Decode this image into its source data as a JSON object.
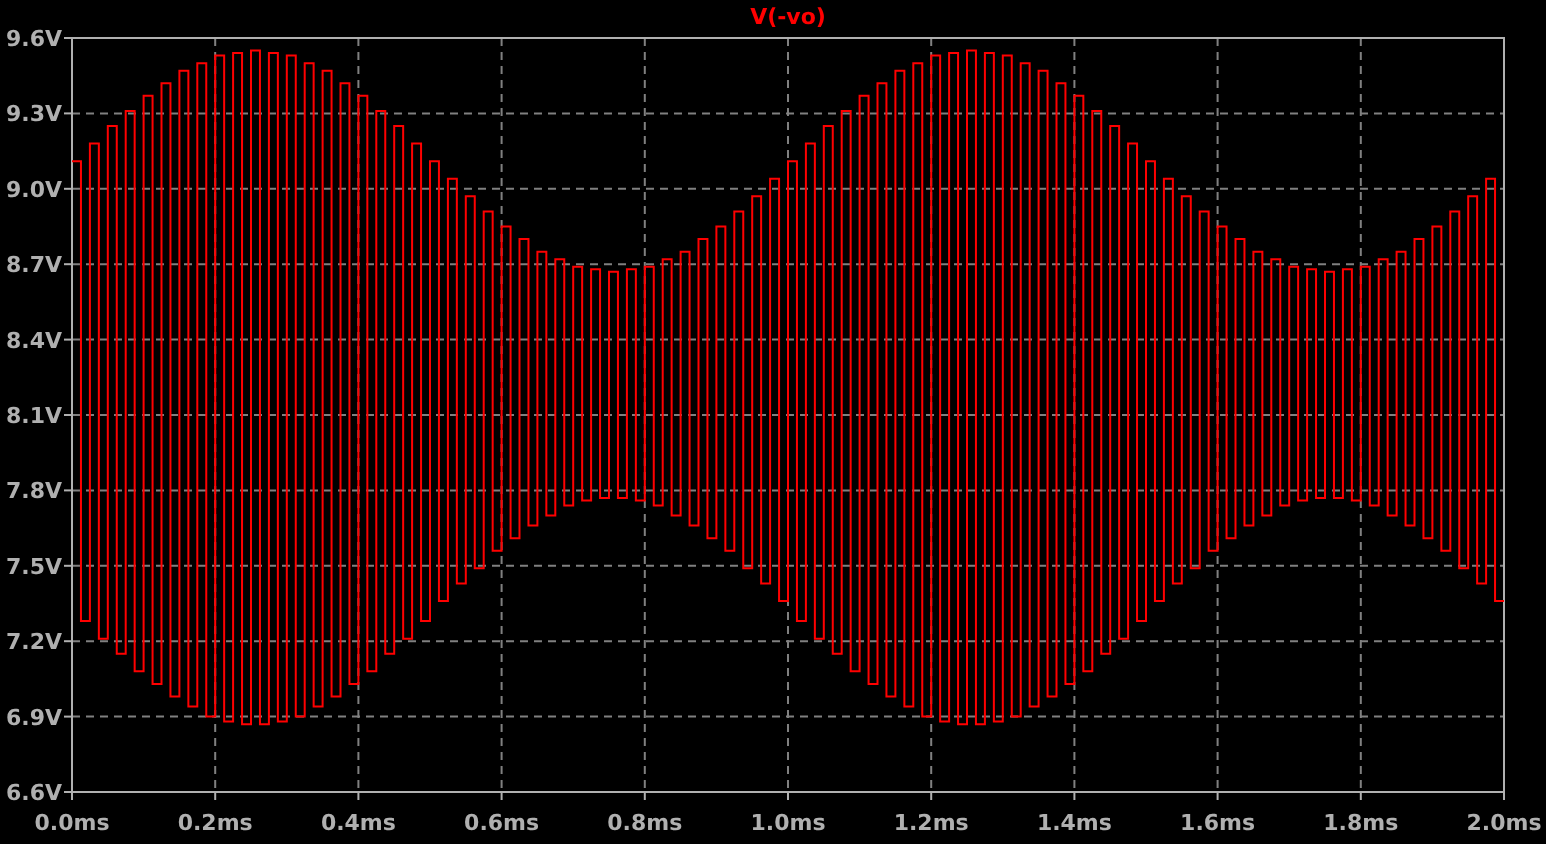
{
  "plot": {
    "chart_data": {
      "type": "line",
      "grid": true,
      "xlim": [
        0,
        2
      ],
      "ylim": [
        6.6,
        9.6
      ],
      "xticks": [
        {
          "value": 0,
          "label": "0.0ms"
        },
        {
          "value": 0.2,
          "label": "0.2ms"
        },
        {
          "value": 0.4,
          "label": "0.4ms"
        },
        {
          "value": 0.6,
          "label": "0.6ms"
        },
        {
          "value": 0.8,
          "label": "0.8ms"
        },
        {
          "value": 1.0,
          "label": "1.0ms"
        },
        {
          "value": 1.2,
          "label": "1.2ms"
        },
        {
          "value": 1.4,
          "label": "1.4ms"
        },
        {
          "value": 1.6,
          "label": "1.6ms"
        },
        {
          "value": 1.8,
          "label": "1.8ms"
        },
        {
          "value": 2.0,
          "label": "2.0ms"
        }
      ],
      "yticks": [
        {
          "value": 6.6,
          "label": "6.6V"
        },
        {
          "value": 6.9,
          "label": "6.9V"
        },
        {
          "value": 7.2,
          "label": "7.2V"
        },
        {
          "value": 7.5,
          "label": "7.5V"
        },
        {
          "value": 7.8,
          "label": "7.8V"
        },
        {
          "value": 8.1,
          "label": "8.1V"
        },
        {
          "value": 8.4,
          "label": "8.4V"
        },
        {
          "value": 8.7,
          "label": "8.7V"
        },
        {
          "value": 9.0,
          "label": "9.0V"
        },
        {
          "value": 9.3,
          "label": "9.3V"
        },
        {
          "value": 9.6,
          "label": "9.6V"
        }
      ],
      "x": [
        0,
        0.0125,
        0.0125,
        0.025,
        0.025,
        0.0375,
        0.0375,
        0.05,
        0.05,
        0.0625,
        0.0625,
        0.075,
        0.075,
        0.0875,
        0.0875,
        0.1,
        0.1,
        0.1125,
        0.1125,
        0.125,
        0.125,
        0.1375,
        0.1375,
        0.15,
        0.15,
        0.1625,
        0.1625,
        0.175,
        0.175,
        0.1875,
        0.1875,
        0.2,
        0.2,
        0.2125,
        0.2125,
        0.225,
        0.225,
        0.2375,
        0.2375,
        0.25,
        0.25,
        0.2625,
        0.2625,
        0.275,
        0.275,
        0.2875,
        0.2875,
        0.3,
        0.3,
        0.3125,
        0.3125,
        0.325,
        0.325,
        0.3375,
        0.3375,
        0.35,
        0.35,
        0.3625,
        0.3625,
        0.375,
        0.375,
        0.3875,
        0.3875,
        0.4,
        0.4,
        0.4125,
        0.4125,
        0.425,
        0.425,
        0.4375,
        0.4375,
        0.45,
        0.45,
        0.4625,
        0.4625,
        0.475,
        0.475,
        0.4875,
        0.4875,
        0.5,
        0.5,
        0.5125,
        0.5125,
        0.525,
        0.525,
        0.5375,
        0.5375,
        0.55,
        0.55,
        0.5625,
        0.5625,
        0.575,
        0.575,
        0.5875,
        0.5875,
        0.6,
        0.6,
        0.6125,
        0.6125,
        0.625,
        0.625,
        0.6375,
        0.6375,
        0.65,
        0.65,
        0.6625,
        0.6625,
        0.675,
        0.675,
        0.6875,
        0.6875,
        0.7,
        0.7,
        0.7125,
        0.7125,
        0.725,
        0.725,
        0.7375,
        0.7375,
        0.75,
        0.75,
        0.7625,
        0.7625,
        0.775,
        0.775,
        0.7875,
        0.7875,
        0.8,
        0.8,
        0.8125,
        0.8125,
        0.825,
        0.825,
        0.8375,
        0.8375,
        0.85,
        0.85,
        0.8625,
        0.8625,
        0.875,
        0.875,
        0.8875,
        0.8875,
        0.9,
        0.9,
        0.9125,
        0.9125,
        0.925,
        0.925,
        0.9375,
        0.9375,
        0.95,
        0.95,
        0.9625,
        0.9625,
        0.975,
        0.975,
        0.9875,
        0.9875,
        1.0,
        1.0,
        1.0125,
        1.0125,
        1.025,
        1.025,
        1.0375,
        1.0375,
        1.05,
        1.05,
        1.0625,
        1.0625,
        1.075,
        1.075,
        1.0875,
        1.0875,
        1.1,
        1.1,
        1.1125,
        1.1125,
        1.125,
        1.125,
        1.1375,
        1.1375,
        1.15,
        1.15,
        1.1625,
        1.1625,
        1.175,
        1.175,
        1.1875,
        1.1875,
        1.2,
        1.2,
        1.2125,
        1.2125,
        1.225,
        1.225,
        1.2375,
        1.2375,
        1.25,
        1.25,
        1.2625,
        1.2625,
        1.275,
        1.275,
        1.2875,
        1.2875,
        1.3,
        1.3,
        1.3125,
        1.3125,
        1.325,
        1.325,
        1.3375,
        1.3375,
        1.35,
        1.35,
        1.3625,
        1.3625,
        1.375,
        1.375,
        1.3875,
        1.3875,
        1.4,
        1.4,
        1.4125,
        1.4125,
        1.425,
        1.425,
        1.4375,
        1.4375,
        1.45,
        1.45,
        1.4625,
        1.4625,
        1.475,
        1.475,
        1.4875,
        1.4875,
        1.5,
        1.5,
        1.5125,
        1.5125,
        1.525,
        1.525,
        1.5375,
        1.5375,
        1.55,
        1.55,
        1.5625,
        1.5625,
        1.575,
        1.575,
        1.5875,
        1.5875,
        1.6,
        1.6,
        1.6125,
        1.6125,
        1.625,
        1.625,
        1.6375,
        1.6375,
        1.65,
        1.65,
        1.6625,
        1.6625,
        1.675,
        1.675,
        1.6875,
        1.6875,
        1.7,
        1.7,
        1.7125,
        1.7125,
        1.725,
        1.725,
        1.7375,
        1.7375,
        1.75,
        1.75,
        1.7625,
        1.7625,
        1.775,
        1.775,
        1.7875,
        1.7875,
        1.8,
        1.8,
        1.8125,
        1.8125,
        1.825,
        1.825,
        1.8375,
        1.8375,
        1.85,
        1.85,
        1.8625,
        1.8625,
        1.875,
        1.875,
        1.8875,
        1.8875,
        1.9,
        1.9,
        1.9125,
        1.9125,
        1.925,
        1.925,
        1.9375,
        1.9375,
        1.95,
        1.95,
        1.9625,
        1.9625,
        1.975,
        1.975,
        1.9875,
        1.9875,
        2.0
      ],
      "series": [
        {
          "name": "V(-vo)",
          "color": "#ff0000",
          "values": [
            9.11,
            9.11,
            7.28,
            7.28,
            9.18,
            9.18,
            7.21,
            7.21,
            9.25,
            9.25,
            7.15,
            7.15,
            9.31,
            9.31,
            7.08,
            7.08,
            9.37,
            9.37,
            7.03,
            7.03,
            9.42,
            9.42,
            6.98,
            6.98,
            9.47,
            9.47,
            6.94,
            6.94,
            9.5,
            9.5,
            6.9,
            6.9,
            9.53,
            9.53,
            6.88,
            6.88,
            9.54,
            9.54,
            6.87,
            6.87,
            9.55,
            9.55,
            6.87,
            6.87,
            9.54,
            9.54,
            6.88,
            6.88,
            9.53,
            9.53,
            6.9,
            6.9,
            9.5,
            9.5,
            6.94,
            6.94,
            9.47,
            9.47,
            6.98,
            6.98,
            9.42,
            9.42,
            7.03,
            7.03,
            9.37,
            9.37,
            7.08,
            7.08,
            9.31,
            9.31,
            7.15,
            7.15,
            9.25,
            9.25,
            7.21,
            7.21,
            9.18,
            9.18,
            7.28,
            7.28,
            9.11,
            9.11,
            7.36,
            7.36,
            9.04,
            9.04,
            7.43,
            7.43,
            8.97,
            8.97,
            7.49,
            7.49,
            8.91,
            8.91,
            7.56,
            7.56,
            8.85,
            8.85,
            7.61,
            7.61,
            8.8,
            8.8,
            7.66,
            7.66,
            8.75,
            8.75,
            7.7,
            7.7,
            8.72,
            8.72,
            7.74,
            7.74,
            8.69,
            8.69,
            7.76,
            7.76,
            8.68,
            8.68,
            7.77,
            7.77,
            8.67,
            8.67,
            7.77,
            7.77,
            8.68,
            8.68,
            7.76,
            7.76,
            8.69,
            8.69,
            7.74,
            7.74,
            8.72,
            8.72,
            7.7,
            7.7,
            8.75,
            8.75,
            7.66,
            7.66,
            8.8,
            8.8,
            7.61,
            7.61,
            8.85,
            8.85,
            7.56,
            7.56,
            8.91,
            8.91,
            7.49,
            7.49,
            8.97,
            8.97,
            7.43,
            7.43,
            9.04,
            9.04,
            7.36,
            7.36,
            9.11,
            9.11,
            7.28,
            7.28,
            9.18,
            9.18,
            7.21,
            7.21,
            9.25,
            9.25,
            7.15,
            7.15,
            9.31,
            9.31,
            7.08,
            7.08,
            9.37,
            9.37,
            7.03,
            7.03,
            9.42,
            9.42,
            6.98,
            6.98,
            9.47,
            9.47,
            6.94,
            6.94,
            9.5,
            9.5,
            6.9,
            6.9,
            9.53,
            9.53,
            6.88,
            6.88,
            9.54,
            9.54,
            6.87,
            6.87,
            9.55,
            9.55,
            6.87,
            6.87,
            9.54,
            9.54,
            6.88,
            6.88,
            9.53,
            9.53,
            6.9,
            6.9,
            9.5,
            9.5,
            6.94,
            6.94,
            9.47,
            9.47,
            6.98,
            6.98,
            9.42,
            9.42,
            7.03,
            7.03,
            9.37,
            9.37,
            7.08,
            7.08,
            9.31,
            9.31,
            7.15,
            7.15,
            9.25,
            9.25,
            7.21,
            7.21,
            9.18,
            9.18,
            7.28,
            7.28,
            9.11,
            9.11,
            7.36,
            7.36,
            9.04,
            9.04,
            7.43,
            7.43,
            8.97,
            8.97,
            7.49,
            7.49,
            8.91,
            8.91,
            7.56,
            7.56,
            8.85,
            8.85,
            7.61,
            7.61,
            8.8,
            8.8,
            7.66,
            7.66,
            8.75,
            8.75,
            7.7,
            7.7,
            8.72,
            8.72,
            7.74,
            7.74,
            8.69,
            8.69,
            7.76,
            7.76,
            8.68,
            8.68,
            7.77,
            7.77,
            8.67,
            8.67,
            7.77,
            7.77,
            8.68,
            8.68,
            7.76,
            7.76,
            8.69,
            8.69,
            7.74,
            7.74,
            8.72,
            8.72,
            7.7,
            7.7,
            8.75,
            8.75,
            7.66,
            7.66,
            8.8,
            8.8,
            7.61,
            7.61,
            8.85,
            8.85,
            7.56,
            7.56,
            8.91,
            8.91,
            7.49,
            7.49,
            8.97,
            8.97,
            7.43,
            7.43,
            9.04,
            9.04,
            7.36,
            7.36
          ]
        }
      ]
    }
  }
}
